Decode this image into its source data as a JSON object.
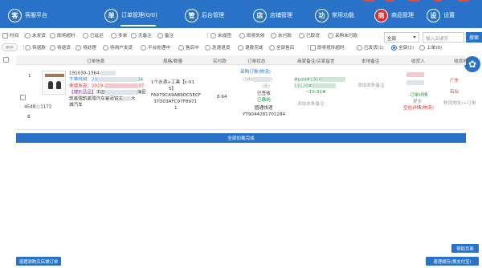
{
  "nav": {
    "items": [
      {
        "icon_char": "客",
        "label": "客服平台"
      },
      {
        "icon_char": "单",
        "label": "订单管理(0/0)"
      },
      {
        "icon_char": "管",
        "label": "后台管理"
      },
      {
        "icon_char": "店",
        "label": "店铺管理"
      },
      {
        "icon_char": "功",
        "label": "常用功能"
      },
      {
        "icon_char": "商",
        "label": "商品管理"
      },
      {
        "icon_char": "设",
        "label": "设置"
      }
    ]
  },
  "filters_row1": [
    {
      "label": "时间",
      "type": "checkbox"
    },
    {
      "label": "未发货",
      "type": "checkbox"
    },
    {
      "label": "即将超时",
      "type": "checkbox"
    },
    {
      "label": "已延迟",
      "type": "checkbox"
    },
    {
      "label": "多单",
      "type": "checkbox"
    },
    {
      "label": "无备注",
      "type": "checkbox"
    },
    {
      "label": "备注",
      "type": "checkbox"
    },
    {
      "label": "未成团",
      "type": "checkbox"
    },
    {
      "label": "即将失效",
      "type": "checkbox"
    },
    {
      "label": "未付款",
      "type": "checkbox"
    },
    {
      "label": "已取消",
      "type": "checkbox"
    },
    {
      "label": "采购未付款",
      "type": "checkbox"
    }
  ],
  "filters_row2": [
    {
      "label": "待退款",
      "type": "radio"
    },
    {
      "label": "待退货",
      "type": "radio"
    },
    {
      "label": "待处理",
      "type": "radio"
    },
    {
      "label": "待用户发货",
      "type": "radio"
    },
    {
      "label": "平台处理中",
      "type": "radio"
    },
    {
      "label": "售后中",
      "type": "radio"
    },
    {
      "label": "急速退货",
      "type": "radio"
    },
    {
      "label": "退款完成",
      "type": "radio"
    },
    {
      "label": "全部售后",
      "type": "radio"
    },
    {
      "label": "即将揽件超时",
      "type": "checkbox"
    },
    {
      "label": "已发货(1)",
      "type": "radio"
    },
    {
      "label": "全部(1)",
      "type": "radio",
      "selected": true
    },
    {
      "label": "上单(0)",
      "type": "radio"
    }
  ],
  "sort_label": "倒序",
  "search": {
    "select_value": "全部",
    "placeholder": "输入关键字",
    "button_label": "搜索"
  },
  "table": {
    "headers": [
      "订单信息",
      "规格/数量",
      "实付款",
      "订单状态",
      "商家备注/买家留言",
      "本地备注",
      "收货人",
      "收货地"
    ]
  },
  "order": {
    "index": "1",
    "id_prefix": "4548",
    "id_suffix": "1172",
    "id_tail": "8",
    "order_no": "191030-1364",
    "order_time_label": "下单时间：20",
    "order_time_suffix": "34",
    "promise_ship_label": "承诺发货：2019-",
    "promise_ship_suffix": "37",
    "tag": "【键形品品】",
    "title_line1": "丰田",
    "title_line1_end": "海尼",
    "title_line2": "凯美瑞凯美瑞汽车皇冠锐志",
    "title_line2_end": "大",
    "title_line3": "城汽车",
    "spec_line1": "1个水滴+工具【c-01",
    "spec_line2": "5】",
    "spec_code1": "FA979CA9AB9DC5ECF",
    "spec_code2": "37D03AFC97F8971",
    "quantity": "1",
    "price": "8.64",
    "status_link": "采购订单(物流)",
    "status_phone": "(180",
    "status_phone_end": ")",
    "status_tag": "(天)",
    "status_shipped": "已签收",
    "status_paid": "已缴纳",
    "carrier": "圆通快递",
    "tracking": "YT9044281701284",
    "remark_link": "#pdd#1910",
    "remark_link2": "13120#",
    "remark_date": "~10-31#",
    "remark_add": "添加本条备注",
    "local_remark_add": "添加本条备注",
    "receiver_status": "订单详情",
    "receiver_more": "更多",
    "receiver_logistics": "空包详情(物流)",
    "addr_line1": "广东",
    "addr_line2": "石业",
    "addr_line3": "物流地址(+订单"
  },
  "load_all_label": "全部加载完成",
  "buttons": {
    "help": "帮助页面",
    "bottom_left": "速理添购买店铺订单",
    "bottom_right": "速理缓存(换支付宝)"
  }
}
